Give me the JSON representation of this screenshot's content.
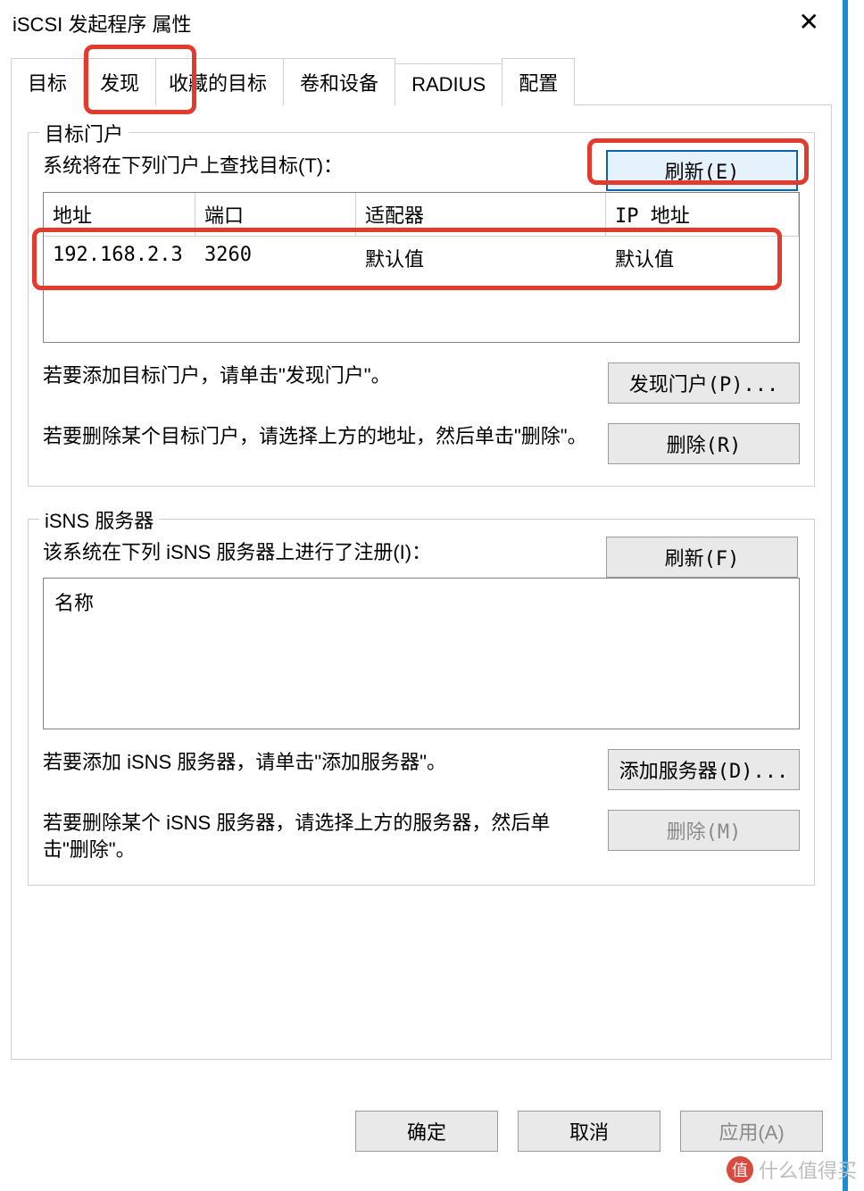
{
  "window": {
    "title": "iSCSI 发起程序 属性",
    "close_glyph": "✕"
  },
  "tabs": {
    "items": [
      {
        "label": "目标"
      },
      {
        "label": "发现",
        "active": true
      },
      {
        "label": "收藏的目标"
      },
      {
        "label": "卷和设备"
      },
      {
        "label": "RADIUS"
      },
      {
        "label": "配置"
      }
    ]
  },
  "target_portal": {
    "legend": "目标门户",
    "desc": "系统将在下列门户上查找目标(T)：",
    "refresh_btn": "刷新(E)",
    "columns": {
      "address": "地址",
      "port": "端口",
      "adapter": "适配器",
      "ip": "IP 地址"
    },
    "rows": [
      {
        "address": "192.168.2.3",
        "port": "3260",
        "adapter": "默认值",
        "ip": "默认值"
      }
    ],
    "add_text": "若要添加目标门户，请单击\"发现门户\"。",
    "discover_btn": "发现门户(P)...",
    "remove_text": "若要删除某个目标门户，请选择上方的地址，然后单击\"删除\"。",
    "remove_btn": "删除(R)"
  },
  "isns": {
    "legend": "iSNS 服务器",
    "desc": "该系统在下列 iSNS 服务器上进行了注册(I)：",
    "refresh_btn": "刷新(F)",
    "name_header": "名称",
    "add_text": "若要添加 iSNS 服务器，请单击\"添加服务器\"。",
    "add_btn": "添加服务器(D)...",
    "remove_text": "若要删除某个 iSNS 服务器，请选择上方的服务器，然后单击\"删除\"。",
    "remove_btn": "删除(M)"
  },
  "footer": {
    "ok": "确定",
    "cancel": "取消",
    "apply": "应用(A)"
  },
  "watermark": {
    "badge": "值",
    "text": "什么值得买"
  }
}
